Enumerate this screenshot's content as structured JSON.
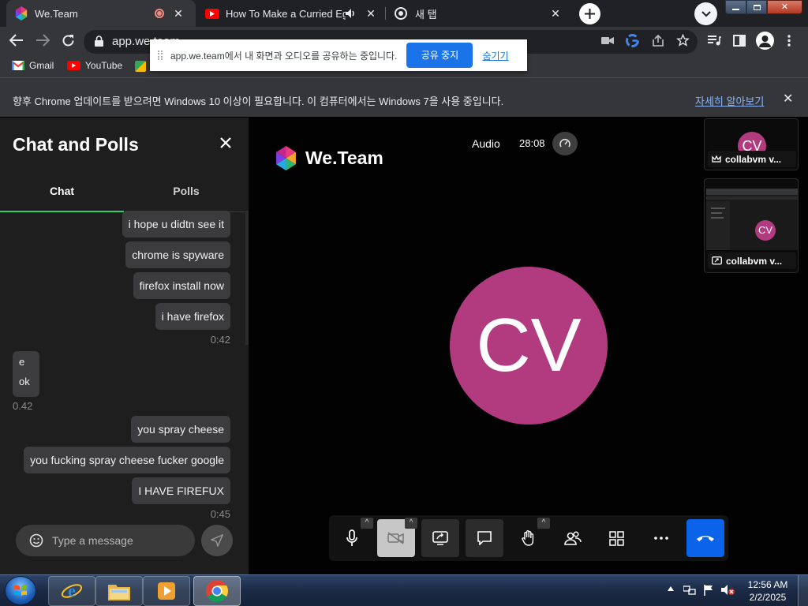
{
  "tabs": [
    {
      "title": "We.Team",
      "favicon": "weteam-logo-icon",
      "indicator": "recording-dot-icon"
    },
    {
      "title": "How To Make a Curried Egg",
      "favicon": "youtube-icon",
      "indicator": "speaker-icon"
    },
    {
      "title": "새 탭",
      "favicon": "chrome-icon"
    }
  ],
  "toolbar": {
    "url": "app.we.team",
    "url_rest": "/...",
    "icons": [
      "back-icon",
      "forward-icon",
      "reload-icon",
      "lock-icon",
      "camera-icon",
      "google-icon",
      "share-icon",
      "star-icon",
      "queue-icon",
      "sidepanel-icon",
      "profile-icon",
      "menu-icon"
    ]
  },
  "bookmarks": [
    {
      "label": "Gmail",
      "icon": "gmail-icon"
    },
    {
      "label": "YouTube",
      "icon": "youtube-icon"
    }
  ],
  "share_notice": {
    "message": "app.we.team에서 내 화면과 오디오를 공유하는 중입니다.",
    "stop_button": "공유 중지",
    "hide_link": "숨기기"
  },
  "info_bar": {
    "message": "향후 Chrome 업데이트를 받으려면 Windows 10 이상이 필요합니다. 이 컴퓨터에서는 Windows 7을 사용 중입니다.",
    "link": "자세히 알아보기"
  },
  "chat": {
    "title": "Chat and Polls",
    "tabs": [
      "Chat",
      "Polls"
    ],
    "active_tab": "Chat",
    "messages_mine_1": [
      "i hope u didtn see it",
      "chrome is spyware",
      "firefox install now",
      "i have firefox"
    ],
    "time_1": "0:42",
    "incoming": [
      "e",
      "ok"
    ],
    "time_2": "0.42",
    "messages_mine_2": [
      "you spray cheese",
      "you fucking spray cheese fucker google",
      "I HAVE FIREFUX"
    ],
    "time_3": "0:45",
    "input_placeholder": "Type a message"
  },
  "meeting": {
    "brand": "We.Team",
    "audio_label": "Audio",
    "timer": "28:08",
    "main_avatar_initials": "CV",
    "avatar_color": "#b23b7f",
    "participants": [
      {
        "initials": "CV",
        "name": "collabvm v...",
        "icon": "crown-icon"
      },
      {
        "initials": "CV",
        "name": "collabvm v...",
        "icon": "screen-share-icon"
      }
    ],
    "controls": [
      "microphone-icon",
      "camera-off-icon",
      "share-screen-icon",
      "chat-icon",
      "raise-hand-icon",
      "participants-icon",
      "grid-icon",
      "more-icon",
      "hang-up-icon"
    ],
    "hangup_color": "#0a63e8"
  },
  "taskbar": {
    "apps": [
      "start-orb-icon",
      "internet-explorer-icon",
      "explorer-icon",
      "media-player-icon",
      "chrome-icon"
    ],
    "time": "12:56 AM",
    "date": "2/2/2025"
  }
}
